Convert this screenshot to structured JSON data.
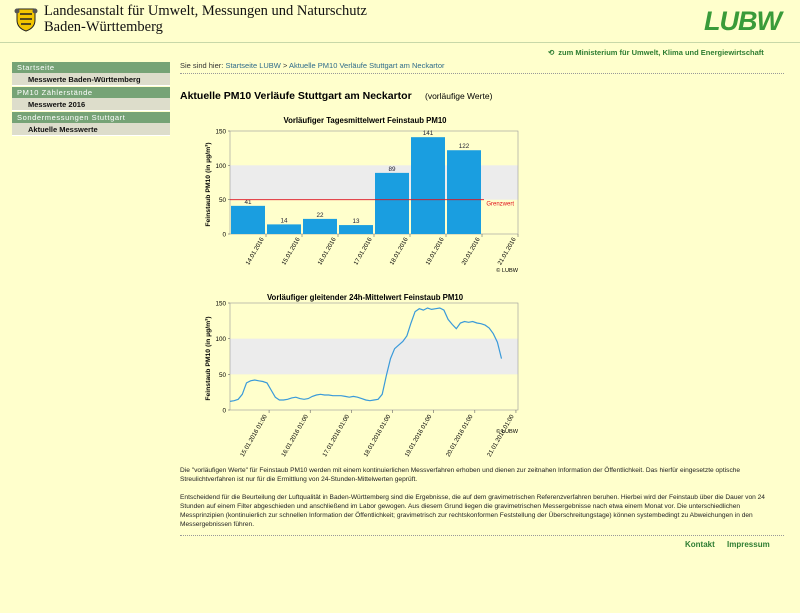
{
  "header": {
    "org_line1": "Landesanstalt für Umwelt, Messungen und Naturschutz",
    "org_line2": "Baden-Württemberg",
    "logo_text": "LUBW",
    "ministry_link": "zum Ministerium für Umwelt, Klima und Energiewirtschaft"
  },
  "breadcrumb": {
    "prefix": "Sie sind hier:",
    "home": "Startseite LUBW",
    "separator": " > ",
    "current": "Aktuelle PM10 Verläufe Stuttgart am Neckartor"
  },
  "sidebar": {
    "items": [
      {
        "label": "Startseite",
        "type": "head"
      },
      {
        "label": "Messwerte Baden-Württemberg",
        "type": "item"
      },
      {
        "label": "PM10 Zählerstände",
        "type": "head"
      },
      {
        "label": "Messwerte 2016",
        "type": "item"
      },
      {
        "label": "Sondermessungen Stuttgart",
        "type": "head"
      },
      {
        "label": "Aktuelle Messwerte",
        "type": "item"
      }
    ]
  },
  "page": {
    "title": "Aktuelle PM10 Verläufe Stuttgart am Neckartor",
    "subtitle": "(vorläufige Werte)"
  },
  "chart_data": [
    {
      "type": "bar",
      "title": "Vorläufiger Tagesmittelwert Feinstaub PM10",
      "ylabel": "Feinstaub PM10 (in µg/m³)",
      "ylim": [
        0,
        150
      ],
      "yticks": [
        0,
        50,
        100,
        150
      ],
      "categories": [
        "14.01.2016",
        "15.01.2016",
        "16.01.2016",
        "17.01.2016",
        "18.01.2016",
        "19.01.2016",
        "20.01.2016",
        "21.01.2016"
      ],
      "values": [
        41,
        14,
        22,
        13,
        89,
        141,
        122,
        null
      ],
      "threshold": {
        "value": 50,
        "label": "Grenzwert",
        "color": "#e0101a"
      },
      "bar_color": "#1a9ee0",
      "credit": "© LUBW"
    },
    {
      "type": "line",
      "title": "Vorläufiger gleitender 24h-Mittelwert Feinstaub PM10",
      "ylabel": "Feinstaub PM10 (in µg/m³)",
      "ylim": [
        0,
        150
      ],
      "yticks": [
        0,
        50,
        100,
        150
      ],
      "xticks": [
        "15.01.2016 01:00",
        "16.01.2016 01:00",
        "17.01.2016 01:00",
        "18.01.2016 01:00",
        "19.01.2016 01:00",
        "20.01.2016 01:00",
        "21.01.2016 01:00"
      ],
      "line_color": "#3a9ad9",
      "series": [
        {
          "x": [
            0,
            0.1,
            0.2,
            0.3,
            0.35,
            0.4,
            0.5,
            0.6,
            0.7,
            0.8,
            0.9,
            1.0,
            1.1,
            1.2,
            1.3,
            1.4,
            1.5,
            1.6,
            1.7,
            1.8,
            1.9,
            2.0,
            2.1,
            2.2,
            2.3,
            2.4,
            2.5,
            2.6,
            2.7,
            2.8,
            2.9,
            3.0,
            3.1,
            3.2,
            3.3,
            3.4,
            3.5,
            3.6,
            3.7,
            3.8,
            3.9,
            4.0,
            4.1,
            4.2,
            4.3,
            4.4,
            4.5,
            4.6,
            4.7,
            4.8,
            4.9,
            5.0,
            5.1,
            5.2,
            5.3,
            5.4,
            5.5,
            5.6,
            5.7,
            5.8,
            5.9,
            6.0,
            6.1,
            6.2,
            6.3,
            6.4,
            6.5,
            6.6
          ],
          "values": [
            12,
            13,
            15,
            22,
            30,
            38,
            41,
            42,
            41,
            40,
            38,
            28,
            18,
            14,
            14,
            15,
            17,
            18,
            16,
            15,
            16,
            19,
            21,
            22,
            21,
            21,
            20,
            20,
            20,
            19,
            18,
            19,
            18,
            16,
            14,
            13,
            14,
            15,
            22,
            48,
            72,
            86,
            91,
            96,
            104,
            122,
            138,
            142,
            140,
            143,
            141,
            142,
            143,
            140,
            127,
            120,
            114,
            122,
            124,
            123,
            124,
            122,
            121,
            119,
            115,
            107,
            95,
            72
          ]
        }
      ],
      "credit": "© LUBW"
    }
  ],
  "text": {
    "para1": "Die \"vorläufigen Werte\" für Feinstaub PM10 werden mit einem kontinuierlichen Messverfahren erhoben und dienen zur zeitnahen Information der Öffentlichkeit. Das hierfür eingesetzte optische Streulichtverfahren ist nur für die Ermittlung von 24-Stunden-Mittelwerten geprüft.",
    "para2": "Entscheidend für die Beurteilung der Luftqualität in Baden-Württemberg sind die Ergebnisse, die auf dem gravimetrischen Referenzverfahren beruhen. Hierbei wird der Feinstaub über die Dauer von 24 Stunden auf einem Filter abgeschieden und anschließend im Labor gewogen. Aus diesem Grund liegen die gravimetrischen Messergebnisse nach etwa einem Monat vor. Die unterschiedlichen Messprinzipien (kontinuierlich zur schnellen Information der Öffentlichkeit; gravimetrisch zur rechtskonformen Feststellung der Überschreitungstage) können systembedingt zu Abweichungen in den Messergebnissen führen."
  },
  "footer": {
    "contact": "Kontakt",
    "imprint": "Impressum"
  },
  "colors": {
    "background": "#ffffcc",
    "sidebar_head": "#76a376",
    "sidebar_item": "#ddddcb",
    "brand_green": "#2e7d32"
  }
}
